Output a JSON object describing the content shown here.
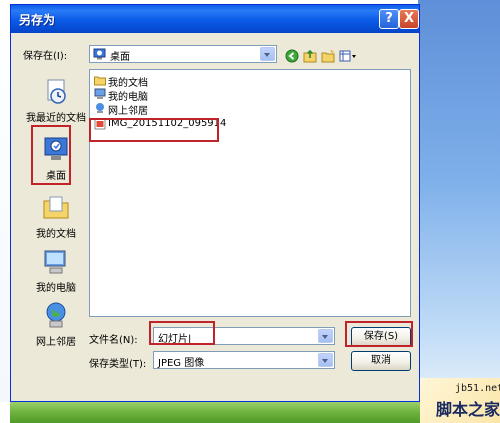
{
  "window": {
    "title": "另存为"
  },
  "titlebar": {
    "help": "?",
    "close": "X"
  },
  "save_in": {
    "label": "保存在(I):",
    "value": "桌面"
  },
  "places": [
    {
      "label": "我最近的文档",
      "icon": "recent-documents-icon"
    },
    {
      "label": "桌面",
      "icon": "desktop-icon"
    },
    {
      "label": "我的文档",
      "icon": "my-documents-icon"
    },
    {
      "label": "我的电脑",
      "icon": "my-computer-icon"
    },
    {
      "label": "网上邻居",
      "icon": "network-places-icon"
    }
  ],
  "files": [
    {
      "name": "我的文档",
      "icon": "folder-icon"
    },
    {
      "name": "我的电脑",
      "icon": "computer-icon"
    },
    {
      "name": "网上邻居",
      "icon": "network-icon"
    },
    {
      "name": "IMG_20151102_095914",
      "icon": "image-file-icon"
    }
  ],
  "filename": {
    "label": "文件名(N):",
    "value": "幻灯片|"
  },
  "filetype": {
    "label": "保存类型(T):",
    "value": "JPEG 图像"
  },
  "buttons": {
    "save": "保存(S)",
    "cancel": "取消"
  },
  "watermark": {
    "site": "jb51.net",
    "name": "脚本之家"
  },
  "colors": {
    "highlight": "#c0242a",
    "titlebar": "#0a5be8"
  }
}
